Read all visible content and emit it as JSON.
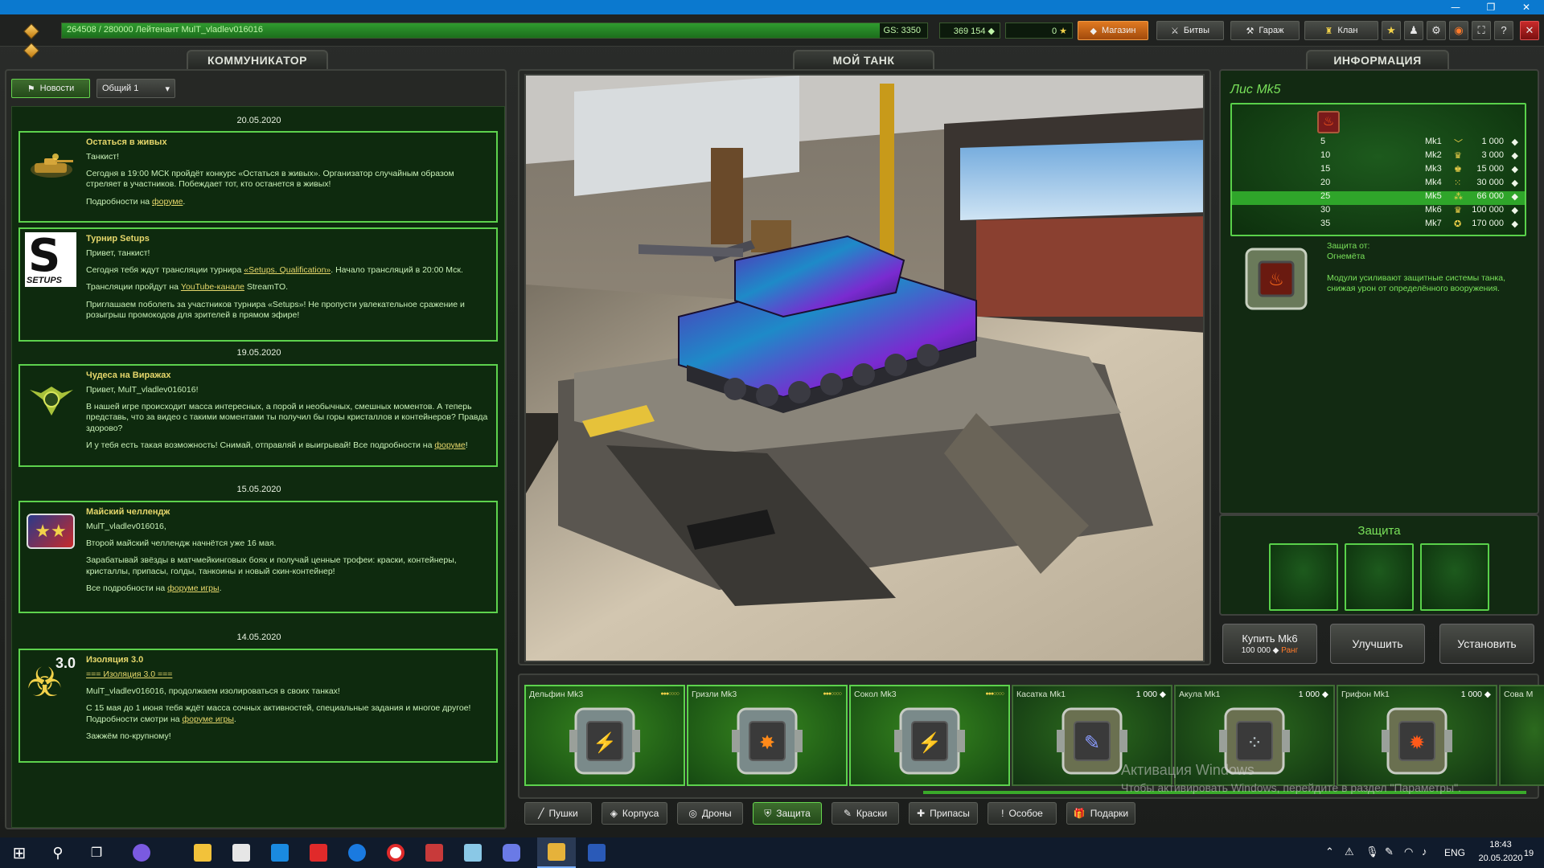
{
  "window": {
    "minimize": "—",
    "restore": "❐",
    "close": "✕"
  },
  "hud": {
    "xp_text": "264508 / 280000  Лейтенант MulT_vladlev016016",
    "xp_progress": 0.945,
    "gs_text": "GS: 3350",
    "crystals": "369 154",
    "stars": "0",
    "shop": "Магазин",
    "battles": "Битвы",
    "garage": "Гараж",
    "clan": "Клан",
    "icons": [
      "star-icon",
      "friends-icon",
      "settings-icon",
      "sound-icon",
      "fullscreen-icon",
      "help-icon",
      "exit-icon"
    ],
    "help": "?"
  },
  "comm": {
    "title": "КОММУНИКАТОР",
    "news_btn": "Новости",
    "channel": "Общий 1",
    "dates": [
      "20.05.2020",
      "19.05.2020",
      "15.05.2020",
      "14.05.2020"
    ],
    "items": [
      {
        "title": "Остаться в живых",
        "lines": [
          "Танкист!",
          "Сегодня в 19:00 МСК пройдёт конкурс «Остаться в живых». Организатор случайным образом стреляет в участников. Побеждает тот, кто останется в живых!"
        ],
        "link_prefix": "Подробности на ",
        "link": "форуме",
        "suffix": "."
      },
      {
        "title": "Турнир  Setups",
        "lines": [
          "Привет, танкист!"
        ],
        "l2_prefix": "Сегодня тебя ждут трансляции турнира ",
        "l2_link": "«Setups. Qualification»",
        "l2_suffix": ". Начало трансляций в 20:00 Мск.",
        "l3_prefix": "Трансляции пройдут на ",
        "l3_link": "YouTube-канале",
        "l3_suffix": " StreamTO.",
        "l4": "Приглашаем поболеть за участников турнира «Setups»! Не пропусти увлекательное сражение и розыгрыш промокодов для зрителей в прямом эфире!"
      },
      {
        "title": "Чудеса на Виражах",
        "lines": [
          "Привет, MulT_vladlev016016!",
          "В нашей игре происходит масса интересных, а порой и необычных, смешных моментов. А теперь представь, что за видео с такими моментами ты получил бы горы кристаллов и контейнеров? Правда здорово?"
        ],
        "l3_prefix": " И у тебя есть такая возможность! Снимай, отправляй и выигрывай! Все подробности на ",
        "l3_link": "форуме",
        "l3_suffix": "!"
      },
      {
        "title": " Майский челлендж",
        "lines": [
          "MulT_vladlev016016,",
          "Второй майский челлендж начнётся уже 16 мая.",
          "Зарабатывай звёзды в матчмейкинговых боях и получай ценные трофеи: краски, контейнеры, кристаллы, припасы, голды, танкоины и новый скин-контейнер!"
        ],
        "link_prefix": "Все подробности на ",
        "link": "форуме игры",
        "suffix": "."
      },
      {
        "title": "Изоляция 3.0",
        "l1_link": "=== Изоляция 3.0 ===",
        "lines": [
          "MulT_vladlev016016, продолжаем изолироваться в своих танках!",
          "С 15 мая до 1 июня тебя ждёт масса сочных активностей, специальные задания и многое другое!"
        ],
        "link_prefix": "Подробности смотри на ",
        "link": "форуме игры",
        "suffix": ".",
        "last": "Зажжём по-крупному!",
        "badge": "3.0"
      }
    ],
    "setups_logo": "SETUPS"
  },
  "tank": {
    "title": "МОЙ ТАНК"
  },
  "info": {
    "title": "ИНФОРМАЦИЯ",
    "name": "Лис Mk5",
    "table": [
      {
        "rank": "5",
        "mk": "Mk1",
        "price": "1 000"
      },
      {
        "rank": "10",
        "mk": "Mk2",
        "price": "3 000"
      },
      {
        "rank": "15",
        "mk": "Mk3",
        "price": "15 000"
      },
      {
        "rank": "20",
        "mk": "Mk4",
        "price": "30 000"
      },
      {
        "rank": "25",
        "mk": "Mk5",
        "price": "66 000"
      },
      {
        "rank": "30",
        "mk": "Mk6",
        "price": "100 000"
      },
      {
        "rank": "35",
        "mk": "Mk7",
        "price": "170 000"
      }
    ],
    "selected_row": 4,
    "protect_label": "Защита от:",
    "protect_from": "Огнемёта",
    "desc": "Модули усиливают защитные системы танка, снижая урон от определённого вооружения.",
    "slots_title": "Защита",
    "buy_label": "Купить Mk6",
    "buy_price": "100 000",
    "buy_rank": "Ранг",
    "upgrade": "Улучшить",
    "install": "Установить"
  },
  "items": [
    {
      "name": "Дельфин Mk3",
      "price": "",
      "glyph": "⚡",
      "glyph_color": "#ffe14a",
      "bought": true
    },
    {
      "name": "Гризли Mk3",
      "price": "",
      "glyph": "✸",
      "glyph_color": "#ff8a1a",
      "bought": true
    },
    {
      "name": "Сокол Mk3",
      "price": "",
      "glyph": "⚡",
      "glyph_color": "#ffb23a",
      "bought": true
    },
    {
      "name": "Касатка Mk1",
      "price": "1 000",
      "glyph": "✎",
      "glyph_color": "#8a9cff",
      "bought": false
    },
    {
      "name": "Акула Mk1",
      "price": "1 000",
      "glyph": "⁘",
      "glyph_color": "#b8c4c8",
      "bought": false
    },
    {
      "name": "Грифон Mk1",
      "price": "1 000",
      "glyph": "✹",
      "glyph_color": "#ff5a1a",
      "bought": false
    },
    {
      "name": "Сова М",
      "price": "",
      "glyph": "",
      "glyph_color": "#ffffff",
      "bought": false
    }
  ],
  "categories": [
    "Пушки",
    "Корпуса",
    "Дроны",
    "Защита",
    "Краски",
    "Припасы",
    "Особое",
    "Подарки"
  ],
  "active_category": 3,
  "watermark": {
    "title": "Активация Windows",
    "sub": "Чтобы активировать Windows, перейдите в раздел \"Параметры\"."
  },
  "taskbar": {
    "lang": "ENG",
    "time": "18:43",
    "date": "20.05.2020",
    "notif": "19"
  }
}
